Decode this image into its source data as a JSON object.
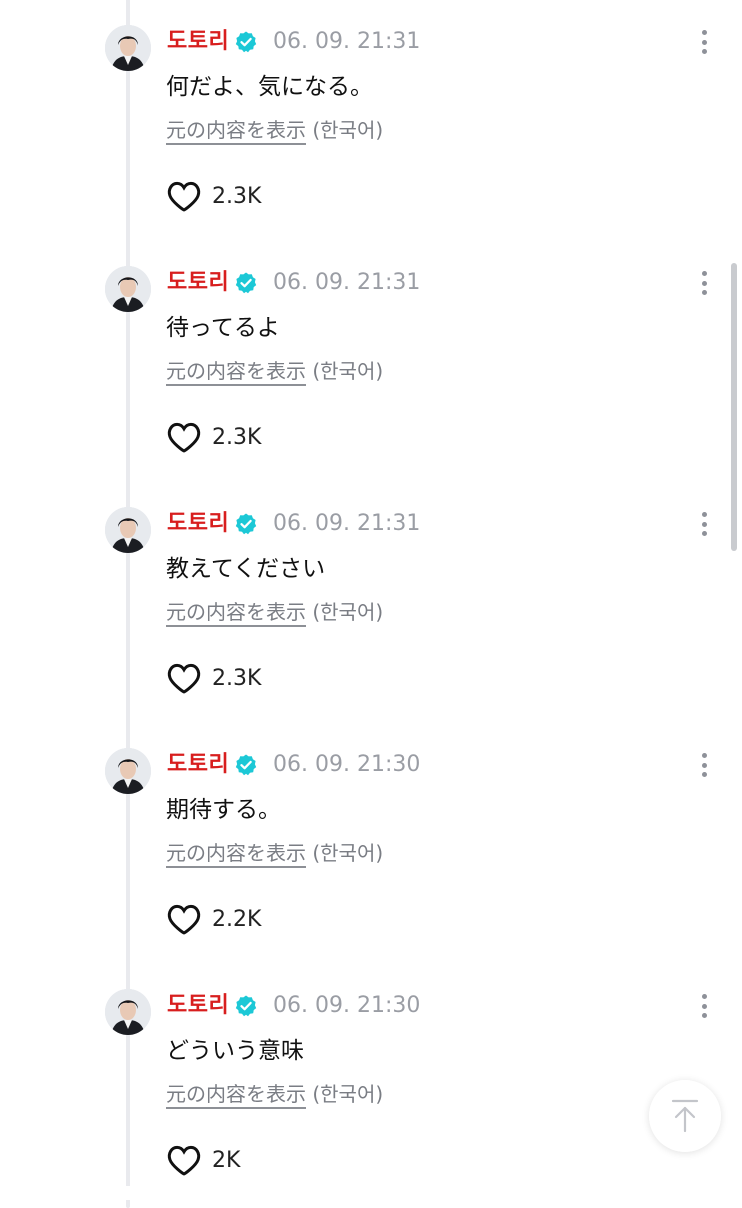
{
  "comments": [
    {
      "author": "도토리",
      "timestamp": "06. 09. 21:31",
      "text": "何だよ、気になる。",
      "translate_link": "元の内容を表示",
      "translate_lang": "(한국어)",
      "likes": "2.3K"
    },
    {
      "author": "도토리",
      "timestamp": "06. 09. 21:31",
      "text": "待ってるよ",
      "translate_link": "元の内容を表示",
      "translate_lang": "(한국어)",
      "likes": "2.3K"
    },
    {
      "author": "도토리",
      "timestamp": "06. 09. 21:31",
      "text": "教えてください",
      "translate_link": "元の内容を表示",
      "translate_lang": "(한국어)",
      "likes": "2.3K"
    },
    {
      "author": "도토리",
      "timestamp": "06. 09. 21:30",
      "text": "期待する。",
      "translate_link": "元の内容を表示",
      "translate_lang": "(한국어)",
      "likes": "2.2K"
    },
    {
      "author": "도토리",
      "timestamp": "06. 09. 21:30",
      "text": "どういう意味",
      "translate_link": "元の内容を表示",
      "translate_lang": "(한국어)",
      "likes": "2K"
    }
  ],
  "icons": {
    "verified": "verified-badge-icon",
    "like": "heart-outline-icon",
    "more": "more-vertical-icon",
    "scroll_top": "arrow-up-to-top-icon"
  },
  "colors": {
    "author_name": "#d81e1e",
    "verified_badge": "#1cc8d6",
    "timestamp": "#9a9da4",
    "thread_line": "#e9eaee"
  }
}
